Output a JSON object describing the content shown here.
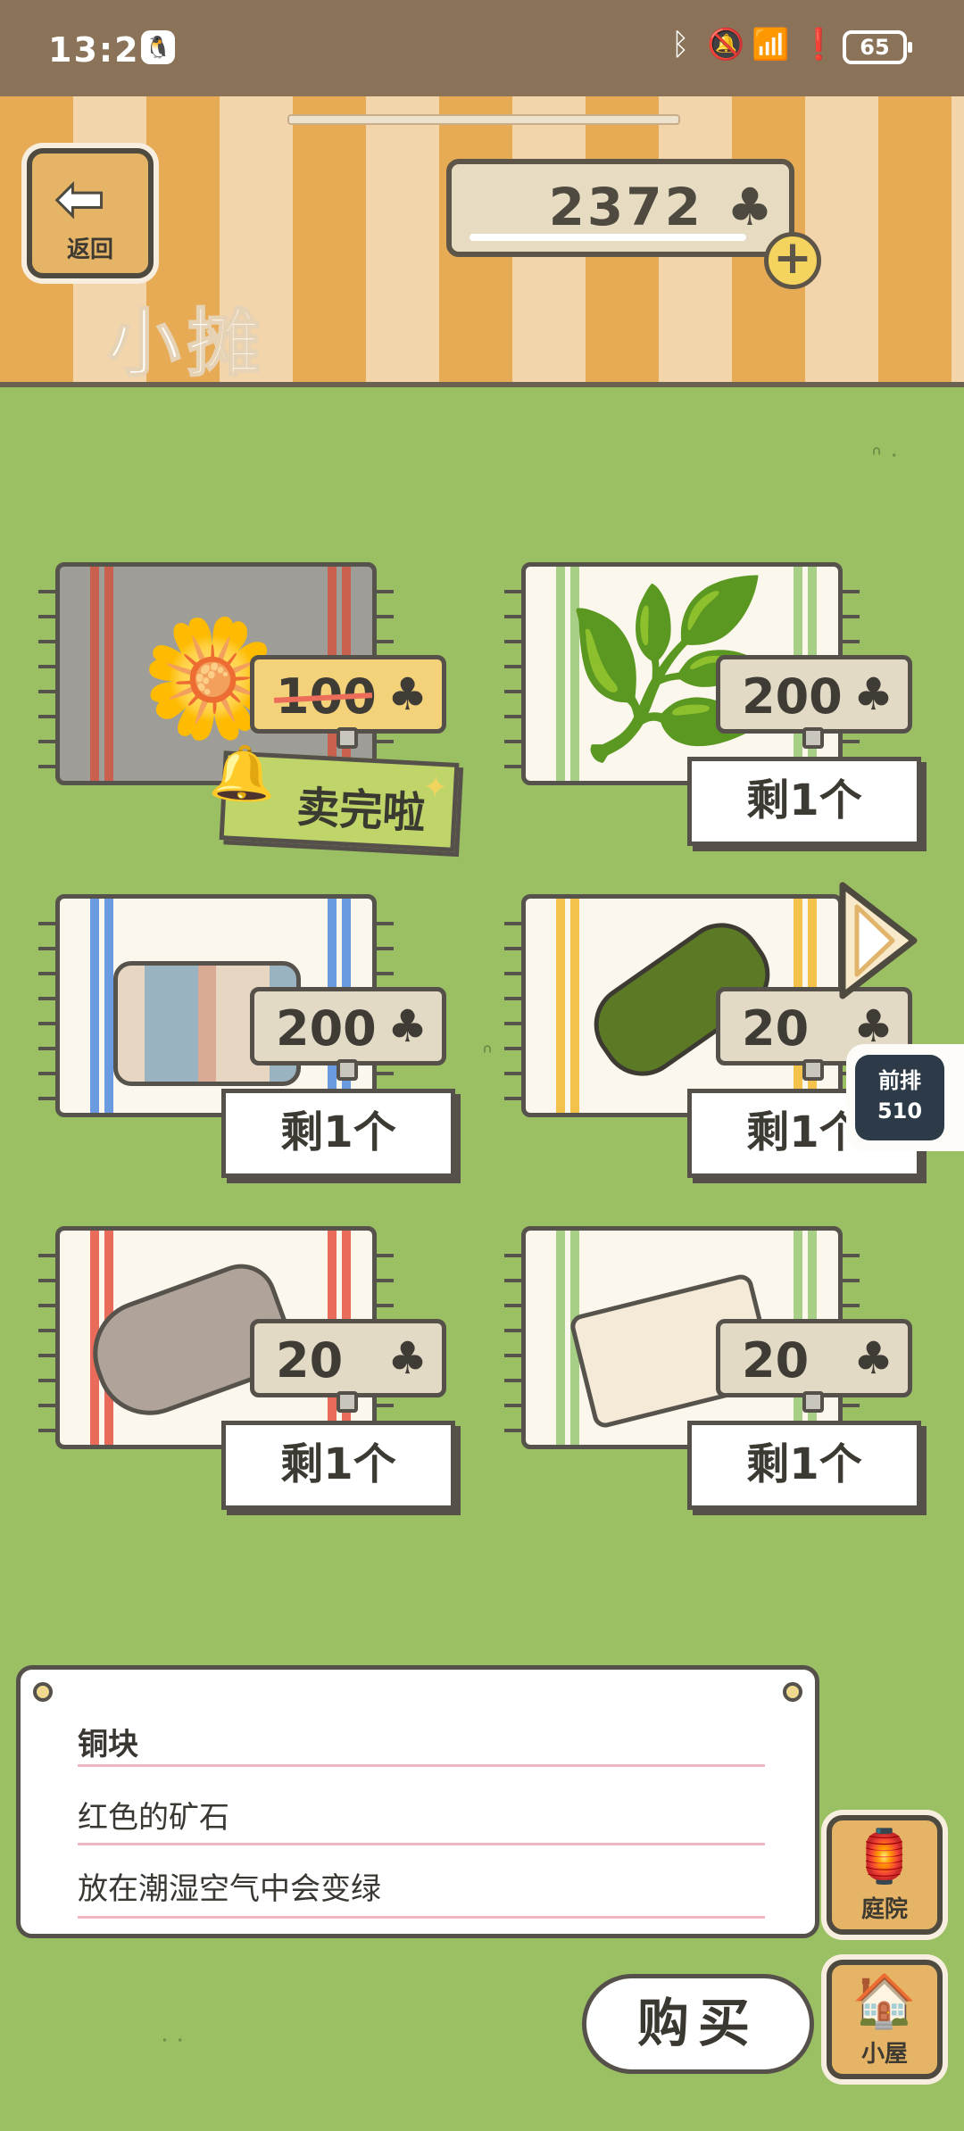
{
  "status_bar": {
    "time": "13:24",
    "battery": "65"
  },
  "header": {
    "back_label": "返回",
    "title": "小摊",
    "currency_amount": "2372",
    "currency_icon": "clover-icon"
  },
  "items": [
    {
      "name": "dandelion",
      "price": "100",
      "sold_out": true,
      "sold_out_label": "卖完啦"
    },
    {
      "name": "leaf",
      "price": "200",
      "stock": "剩1个"
    },
    {
      "name": "towel",
      "price": "200",
      "stock": "剩1个"
    },
    {
      "name": "bamboo",
      "price": "20",
      "stock": "剩1个"
    },
    {
      "name": "cloth-roll",
      "price": "20",
      "stock": "剩1个"
    },
    {
      "name": "paper",
      "price": "20",
      "stock": "剩1个"
    }
  ],
  "side_badge": {
    "line1": "前排",
    "line2": "510"
  },
  "description": {
    "title": "铜块",
    "line1": "红色的矿石",
    "line2": "放在潮湿空气中会变绿"
  },
  "buttons": {
    "buy": "购买",
    "yard": "庭院",
    "house": "小屋"
  }
}
